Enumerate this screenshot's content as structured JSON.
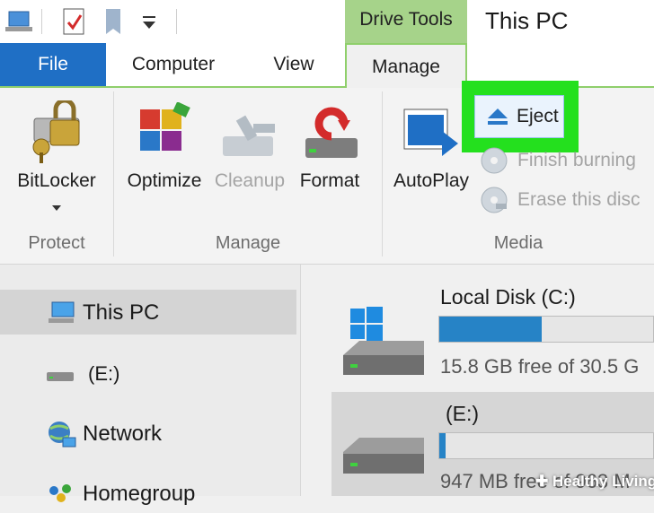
{
  "ribbon_tabs": {
    "file": "File",
    "computer": "Computer",
    "view": "View",
    "manage": "Manage",
    "contextual_group": "Drive Tools"
  },
  "window_title": "This PC",
  "ribbon": {
    "protect": {
      "group_label": "Protect",
      "bitlocker": "BitLocker"
    },
    "manage": {
      "group_label": "Manage",
      "optimize": "Optimize",
      "cleanup": "Cleanup",
      "format": "Format"
    },
    "media": {
      "group_label": "Media",
      "autoplay": "AutoPlay",
      "eject": "Eject",
      "finish_burning": "Finish burning",
      "erase_disc": "Erase this disc"
    }
  },
  "navigation": {
    "items": [
      {
        "label": "This PC",
        "icon": "computer-icon",
        "selected": true
      },
      {
        "label": "(E:)",
        "icon": "drive-icon"
      },
      {
        "label": "Network",
        "icon": "network-icon"
      },
      {
        "label": "Homegroup",
        "icon": "homegroup-icon"
      }
    ]
  },
  "drives": [
    {
      "name": "Local Disk (C:)",
      "free_text": "15.8 GB free of 30.5 G",
      "used_fraction": 0.48
    },
    {
      "name": "(E:)",
      "free_text": "947 MB free of 963 M",
      "used_fraction": 0.03,
      "selected": true
    }
  ],
  "watermark": "Healthy Living",
  "colors": {
    "file_tab": "#1f6fc5",
    "drive_tools": "#a6d38a",
    "highlight": "#24e01e",
    "capacity_bar": "#2683c6"
  }
}
